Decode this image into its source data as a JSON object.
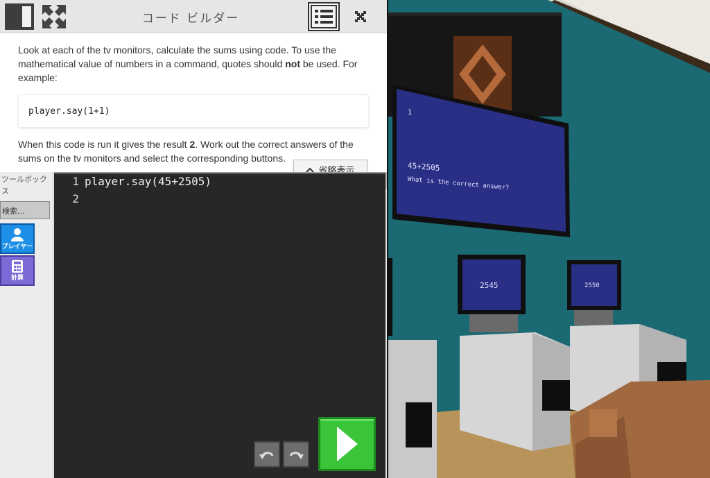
{
  "header": {
    "title": "コード ビルダー",
    "icons": [
      "panel-toggle-icon",
      "fullscreen-icon",
      "list-icon",
      "close-icon"
    ]
  },
  "instructions": {
    "paragraph1": "Look at each of the tv monitors, calculate the sums using code. To use the mathematical value of numbers in a command, quotes should <b>not</b> be used. For example:",
    "example_code": "player.say(1+1)",
    "paragraph2": "When this code is run it gives the result <b>2</b>. Work out the correct answers of the sums on the tv monitors and select the corresponding buttons.",
    "collapse_label": "省略表示"
  },
  "toolbox": {
    "label": "ツールボックス",
    "search_placeholder": "検索...",
    "categories": [
      {
        "label": "プレイヤー",
        "color": "#1e8fe6",
        "icon": "person-icon"
      },
      {
        "label": "計算",
        "color": "#7b6bd6",
        "icon": "calculator-icon"
      }
    ]
  },
  "editor": {
    "lines": [
      {
        "number": "1",
        "text": "player.say(45+2505)"
      },
      {
        "number": "2",
        "text": ""
      }
    ],
    "undo_icon": "undo-icon",
    "redo_icon": "redo-icon",
    "run_icon": "play-icon"
  },
  "world": {
    "big_screen": {
      "line1": "1",
      "line2": "45+2505",
      "line3": "What is the correct answer?"
    },
    "monitors": [
      {
        "value": "2545"
      },
      {
        "value": "2550"
      }
    ],
    "colors": {
      "wall": "#1b6a73",
      "screen": "#2a2f86",
      "floor": "#b8935a"
    }
  }
}
